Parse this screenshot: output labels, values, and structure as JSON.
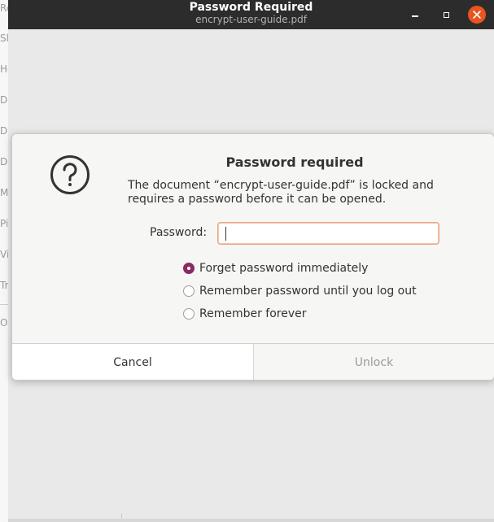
{
  "window": {
    "title": "Password Required",
    "subtitle": "encrypt-user-guide.pdf",
    "controls": [
      "minimize",
      "maximize",
      "close"
    ]
  },
  "background_sidebar": {
    "fragments": [
      "Re",
      "Sl",
      "Ho",
      "Do",
      "Do",
      "Do",
      "M",
      "Pi",
      "Vi",
      "Tr",
      "O"
    ]
  },
  "dialog": {
    "icon": "question-circle-icon",
    "heading": "Password required",
    "message": "The document “encrypt-user-guide.pdf” is locked and requires a password before it can be opened.",
    "password_label": "Password:",
    "password_value": "",
    "options": [
      {
        "label": "Forget password immediately",
        "checked": true
      },
      {
        "label": "Remember password until you log out",
        "checked": false
      },
      {
        "label": "Remember forever",
        "checked": false
      }
    ],
    "buttons": {
      "cancel": "Cancel",
      "unlock": "Unlock"
    },
    "unlock_enabled": false
  },
  "colors": {
    "titlebar": "#2c2c2c",
    "close_button": "#e95420",
    "radio_checked": "#8b2a61",
    "input_focus_border": "#e8a77f"
  }
}
